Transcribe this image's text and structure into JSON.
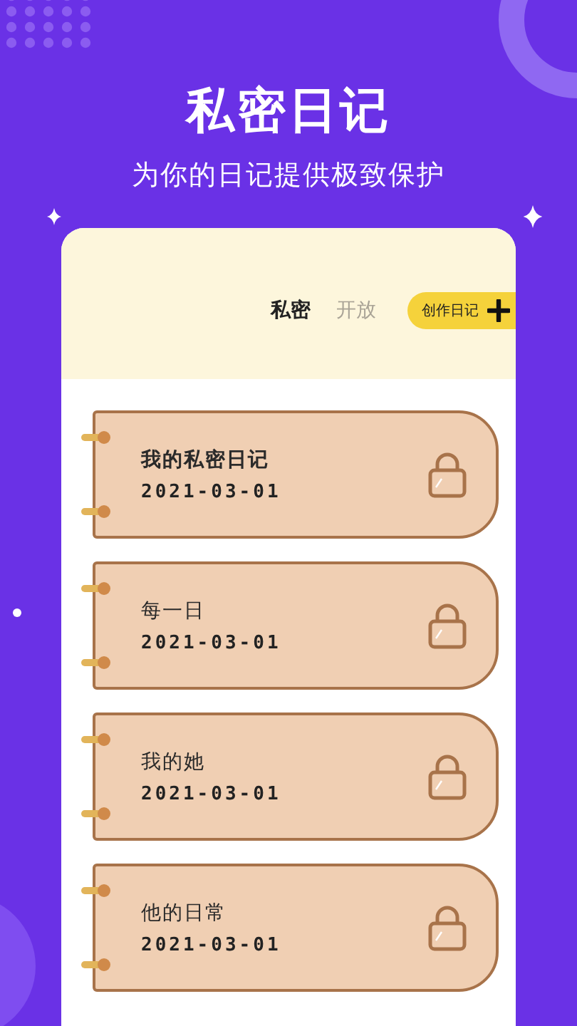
{
  "title": "私密日记",
  "subtitle": "为你的日记提供极致保护",
  "tabs": [
    {
      "label": "私密",
      "selected": true
    },
    {
      "label": "开放",
      "selected": false
    }
  ],
  "create_button": {
    "label": "创作日记"
  },
  "diaries": [
    {
      "title": "我的私密日记",
      "date": "2021-03-01",
      "bold": true
    },
    {
      "title": "每一日",
      "date": "2021-03-01",
      "bold": false
    },
    {
      "title": "我的她",
      "date": "2021-03-01",
      "bold": false
    },
    {
      "title": "他的日常",
      "date": "2021-03-01",
      "bold": false
    }
  ]
}
